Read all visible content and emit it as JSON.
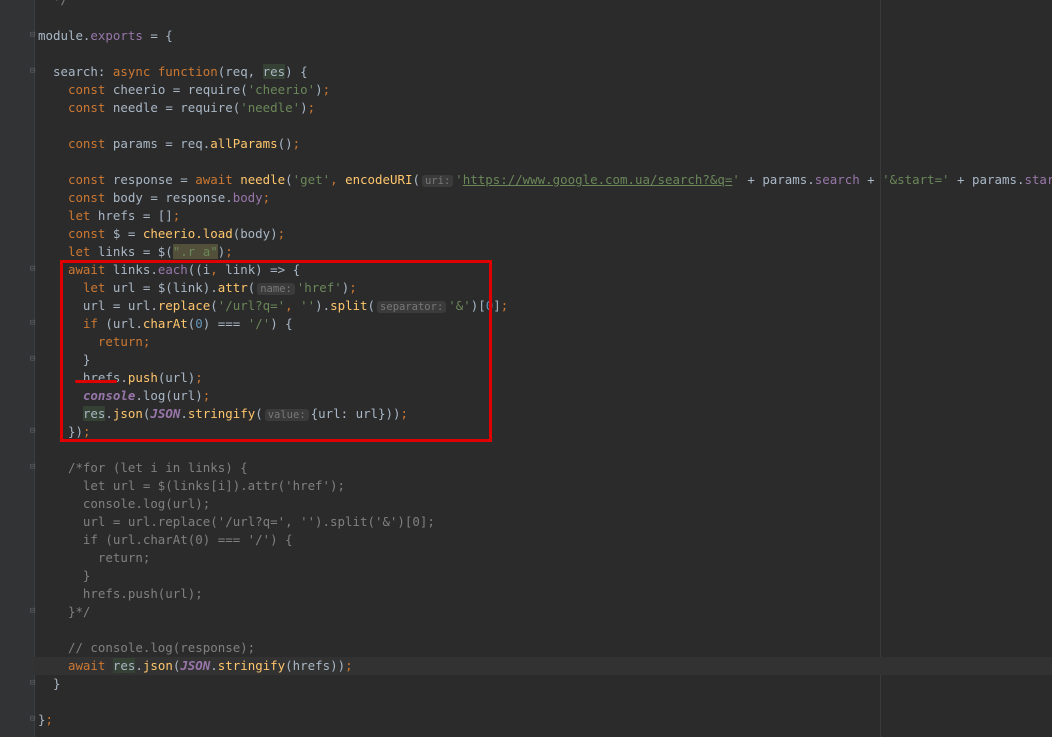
{
  "editor": {
    "colors": {
      "background": "#2b2b2b",
      "gutter": "#313335",
      "annotation": "#e00000"
    },
    "current_line": 37,
    "lines": [
      [
        [
          "  */",
          "comment"
        ]
      ],
      [],
      [
        [
          "module.",
          ""
        ],
        [
          "exports",
          "prop"
        ],
        [
          " = {",
          ""
        ]
      ],
      [],
      [
        [
          "  search",
          ""
        ],
        [
          ": ",
          ""
        ],
        [
          "async function",
          "kw"
        ],
        [
          "(req, ",
          ""
        ],
        [
          "res",
          "hl"
        ],
        [
          ") {",
          ""
        ]
      ],
      [
        [
          "    ",
          ""
        ],
        [
          "const ",
          "kw"
        ],
        [
          "cheerio",
          ""
        ],
        [
          " = require(",
          ""
        ],
        [
          "'cheerio'",
          "str"
        ],
        [
          ")",
          ""
        ],
        [
          ";",
          "punct"
        ]
      ],
      [
        [
          "    ",
          ""
        ],
        [
          "const ",
          "kw"
        ],
        [
          "needle",
          ""
        ],
        [
          " = require(",
          ""
        ],
        [
          "'needle'",
          "str"
        ],
        [
          ")",
          ""
        ],
        [
          ";",
          "punct"
        ]
      ],
      [],
      [
        [
          "    ",
          ""
        ],
        [
          "const ",
          "kw"
        ],
        [
          "params = req.",
          ""
        ],
        [
          "allParams",
          "fn"
        ],
        [
          "()",
          ""
        ],
        [
          ";",
          "punct"
        ]
      ],
      [],
      [
        [
          "    ",
          ""
        ],
        [
          "const ",
          "kw"
        ],
        [
          "response = ",
          ""
        ],
        [
          "await ",
          "kw"
        ],
        [
          "needle",
          "fn"
        ],
        [
          "(",
          ""
        ],
        [
          "'get'",
          "str"
        ],
        [
          ", ",
          "punct"
        ],
        [
          "encodeURI",
          "fn"
        ],
        [
          "(",
          ""
        ],
        [
          "uri:",
          "hint"
        ],
        [
          "'",
          "str"
        ],
        [
          "https://www.google.com.ua/search?&q=",
          "url"
        ],
        [
          "'",
          "str"
        ],
        [
          " + params.",
          ""
        ],
        [
          "search",
          "prop"
        ],
        [
          " + ",
          ""
        ],
        [
          "'&start='",
          "str"
        ],
        [
          " + params.",
          ""
        ],
        [
          "start",
          "prop"
        ],
        [
          "))",
          ""
        ],
        [
          ";",
          "punct"
        ]
      ],
      [
        [
          "    ",
          ""
        ],
        [
          "const ",
          "kw"
        ],
        [
          "body = response.",
          ""
        ],
        [
          "body",
          "prop"
        ],
        [
          ";",
          "punct"
        ]
      ],
      [
        [
          "    ",
          ""
        ],
        [
          "let ",
          "kw"
        ],
        [
          "hrefs = []",
          ""
        ],
        [
          ";",
          "punct"
        ]
      ],
      [
        [
          "    ",
          ""
        ],
        [
          "const ",
          "kw"
        ],
        [
          "$ = ",
          ""
        ],
        [
          "cheerio.load",
          "fn"
        ],
        [
          "(body)",
          ""
        ],
        [
          ";",
          "punct"
        ]
      ],
      [
        [
          "    ",
          ""
        ],
        [
          "let ",
          "kw"
        ],
        [
          "links = $(",
          ""
        ],
        [
          "\".r a\"",
          "sel"
        ],
        [
          ")",
          ""
        ],
        [
          ";",
          "punct"
        ]
      ],
      [
        [
          "    ",
          ""
        ],
        [
          "await ",
          "kw"
        ],
        [
          "links.",
          ""
        ],
        [
          "each",
          "prop"
        ],
        [
          "((i",
          ""
        ],
        [
          ", ",
          "punct"
        ],
        [
          "link) => {",
          ""
        ]
      ],
      [
        [
          "      ",
          ""
        ],
        [
          "let ",
          "kw"
        ],
        [
          "url = $(link).",
          ""
        ],
        [
          "attr",
          "fn"
        ],
        [
          "(",
          ""
        ],
        [
          "name:",
          "hint"
        ],
        [
          "'href'",
          "str"
        ],
        [
          ")",
          ""
        ],
        [
          ";",
          "punct"
        ]
      ],
      [
        [
          "      url = url.",
          ""
        ],
        [
          "replace",
          "fn"
        ],
        [
          "(",
          ""
        ],
        [
          "'/url?q='",
          "str"
        ],
        [
          ", ",
          "punct"
        ],
        [
          "''",
          "str"
        ],
        [
          ").",
          ""
        ],
        [
          "split",
          "fn"
        ],
        [
          "(",
          ""
        ],
        [
          "separator:",
          "hint"
        ],
        [
          "'&'",
          "str"
        ],
        [
          ")[",
          ""
        ],
        [
          "0",
          "num"
        ],
        [
          "]",
          ""
        ],
        [
          ";",
          "punct"
        ]
      ],
      [
        [
          "      ",
          ""
        ],
        [
          "if ",
          "kw"
        ],
        [
          "(url.",
          ""
        ],
        [
          "charAt",
          "fn"
        ],
        [
          "(",
          ""
        ],
        [
          "0",
          "num"
        ],
        [
          ") === ",
          ""
        ],
        [
          "'/'",
          "str"
        ],
        [
          ") {",
          ""
        ]
      ],
      [
        [
          "        ",
          ""
        ],
        [
          "return",
          "kw"
        ],
        [
          ";",
          "punct"
        ]
      ],
      [
        [
          "      }",
          ""
        ]
      ],
      [
        [
          "      hrefs.",
          ""
        ],
        [
          "push",
          "fn"
        ],
        [
          "(url)",
          ""
        ],
        [
          ";",
          "punct"
        ]
      ],
      [
        [
          "      ",
          ""
        ],
        [
          "console",
          "glob"
        ],
        [
          ".log(url)",
          ""
        ],
        [
          ";",
          "punct"
        ]
      ],
      [
        [
          "      ",
          ""
        ],
        [
          "res",
          "hl"
        ],
        [
          ".",
          ""
        ],
        [
          "json",
          "fn"
        ],
        [
          "(",
          ""
        ],
        [
          "JSON",
          "glob"
        ],
        [
          ".",
          ""
        ],
        [
          "stringify",
          "fn"
        ],
        [
          "(",
          ""
        ],
        [
          "value:",
          "hint"
        ],
        [
          "{url: url}))",
          ""
        ],
        [
          ";",
          "punct"
        ]
      ],
      [
        [
          "    })",
          ""
        ],
        [
          ";",
          "punct"
        ]
      ],
      [],
      [
        [
          "    /*for (let i in links) {",
          "comment"
        ]
      ],
      [
        [
          "      let url = $(links[i]).attr('href');",
          "comment"
        ]
      ],
      [
        [
          "      console.log(url);",
          "comment"
        ]
      ],
      [
        [
          "      url = url.replace('/url?q=', '').split('&')[0];",
          "comment"
        ]
      ],
      [
        [
          "      if (url.charAt(0) === '/') {",
          "comment"
        ]
      ],
      [
        [
          "        return;",
          "comment"
        ]
      ],
      [
        [
          "      }",
          "comment"
        ]
      ],
      [
        [
          "      hrefs.push(url);",
          "comment"
        ]
      ],
      [
        [
          "    }*/",
          "comment"
        ]
      ],
      [],
      [
        [
          "    // console.log(response);",
          "comment"
        ]
      ],
      [
        [
          "    ",
          ""
        ],
        [
          "await ",
          "kw"
        ],
        [
          "res",
          "hl"
        ],
        [
          ".",
          ""
        ],
        [
          "json",
          "fn"
        ],
        [
          "(",
          ""
        ],
        [
          "JSON",
          "glob"
        ],
        [
          ".",
          ""
        ],
        [
          "stringify",
          "fn"
        ],
        [
          "(hrefs))",
          ""
        ],
        [
          ";",
          "punct"
        ]
      ],
      [
        [
          "  }",
          ""
        ]
      ],
      [],
      [
        [
          "}",
          ""
        ],
        [
          ";",
          "punct"
        ]
      ]
    ],
    "fold_markers": [
      2,
      4,
      15,
      18,
      20,
      24,
      26,
      34,
      38,
      40
    ]
  }
}
